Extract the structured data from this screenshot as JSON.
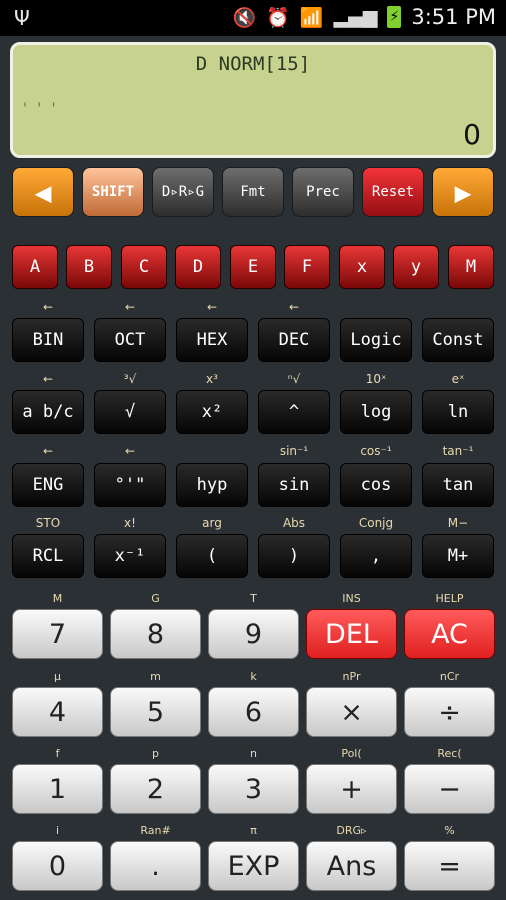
{
  "status": {
    "usb_icon": "usb-icon",
    "time": "3:51 PM",
    "battery_glyph": "⚡"
  },
  "display": {
    "expression": "D NORM[15]",
    "indicator": "' ' '",
    "result": "0"
  },
  "function_row": {
    "left_arrow": "◀",
    "shift": "SHIFT",
    "drg": "D▹R▹G",
    "fmt": "Fmt",
    "prec": "Prec",
    "reset": "Reset",
    "right_arrow": "▶"
  },
  "letters": [
    "A",
    "B",
    "C",
    "D",
    "E",
    "F",
    "x",
    "y",
    "M"
  ],
  "row1": {
    "keys": [
      "BIN",
      "OCT",
      "HEX",
      "DEC",
      "Logic",
      "Const"
    ],
    "shift": [
      "←",
      "←",
      "←",
      "←",
      "",
      ""
    ]
  },
  "row2": {
    "keys": [
      "a b/c",
      "√",
      "x²",
      "^",
      "log",
      "ln"
    ],
    "shift": [
      "←",
      "³√",
      "x³",
      "ⁿ√",
      "10ˣ",
      "eˣ"
    ]
  },
  "row3": {
    "keys": [
      "ENG",
      "°'\"",
      "hyp",
      "sin",
      "cos",
      "tan"
    ],
    "shift": [
      "←",
      "←",
      "",
      "sin⁻¹",
      "cos⁻¹",
      "tan⁻¹"
    ]
  },
  "row4": {
    "keys": [
      "RCL",
      "x⁻¹",
      "(",
      ")",
      ",",
      "M+"
    ],
    "shift": [
      "STO",
      "x!",
      "arg",
      "Abs",
      "Conjg",
      "M−"
    ]
  },
  "num1": {
    "keys": [
      "7",
      "8",
      "9",
      "DEL",
      "AC"
    ],
    "shift": [
      "M",
      "G",
      "T",
      "INS",
      "HELP"
    ]
  },
  "num2": {
    "keys": [
      "4",
      "5",
      "6",
      "×",
      "÷"
    ],
    "shift": [
      "μ",
      "m",
      "k",
      "nPr",
      "nCr"
    ]
  },
  "num3": {
    "keys": [
      "1",
      "2",
      "3",
      "+",
      "−"
    ],
    "shift": [
      "f",
      "p",
      "n",
      "Pol(",
      "Rec("
    ]
  },
  "num4": {
    "keys": [
      "0",
      ".",
      "EXP",
      "Ans",
      "="
    ],
    "shift": [
      "i",
      "Ran#",
      "π",
      "DRG▹",
      "%"
    ]
  }
}
